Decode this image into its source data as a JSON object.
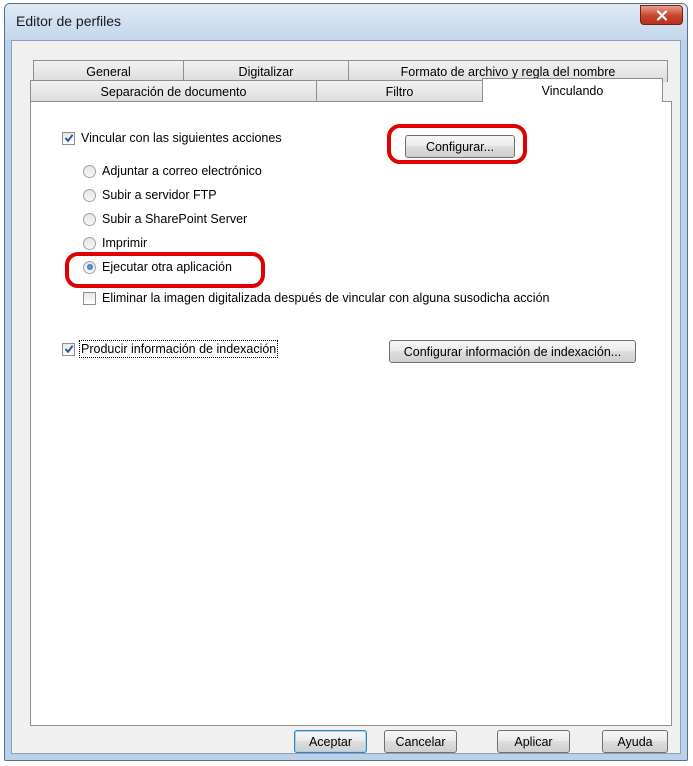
{
  "window": {
    "title": "Editor de perfiles"
  },
  "tabs_back": [
    {
      "label": "General"
    },
    {
      "label": "Digitalizar"
    },
    {
      "label": "Formato de archivo y regla del nombre"
    }
  ],
  "tabs_front": [
    {
      "label": "Separación de documento"
    },
    {
      "label": "Filtro"
    },
    {
      "label": "Vinculando"
    }
  ],
  "link_option": {
    "label": "Vincular con las siguientes acciones",
    "checked": true
  },
  "configure_button": {
    "label": "Configurar..."
  },
  "radios": [
    {
      "label": "Adjuntar a correo electrónico",
      "selected": false
    },
    {
      "label": "Subir a servidor FTP",
      "selected": false
    },
    {
      "label": "Subir a SharePoint Server",
      "selected": false
    },
    {
      "label": "Imprimir",
      "selected": false
    },
    {
      "label": "Ejecutar otra aplicación",
      "selected": true
    }
  ],
  "delete_option": {
    "label": "Eliminar la imagen digitalizada después de vincular con alguna susodicha acción",
    "checked": false
  },
  "index_option": {
    "label": "Producir información de indexación",
    "checked": true
  },
  "index_config_button": {
    "label": "Configurar información de indexación..."
  },
  "footer": {
    "ok": "Aceptar",
    "cancel": "Cancelar",
    "apply": "Aplicar",
    "help": "Ayuda"
  },
  "colors": {
    "highlight": "#e00000",
    "close_button": "#c7432a",
    "check": "#1a4f9e"
  },
  "icons": {
    "close": "close-icon",
    "check": "checkmark-icon",
    "radio": "radio-dot-icon"
  }
}
